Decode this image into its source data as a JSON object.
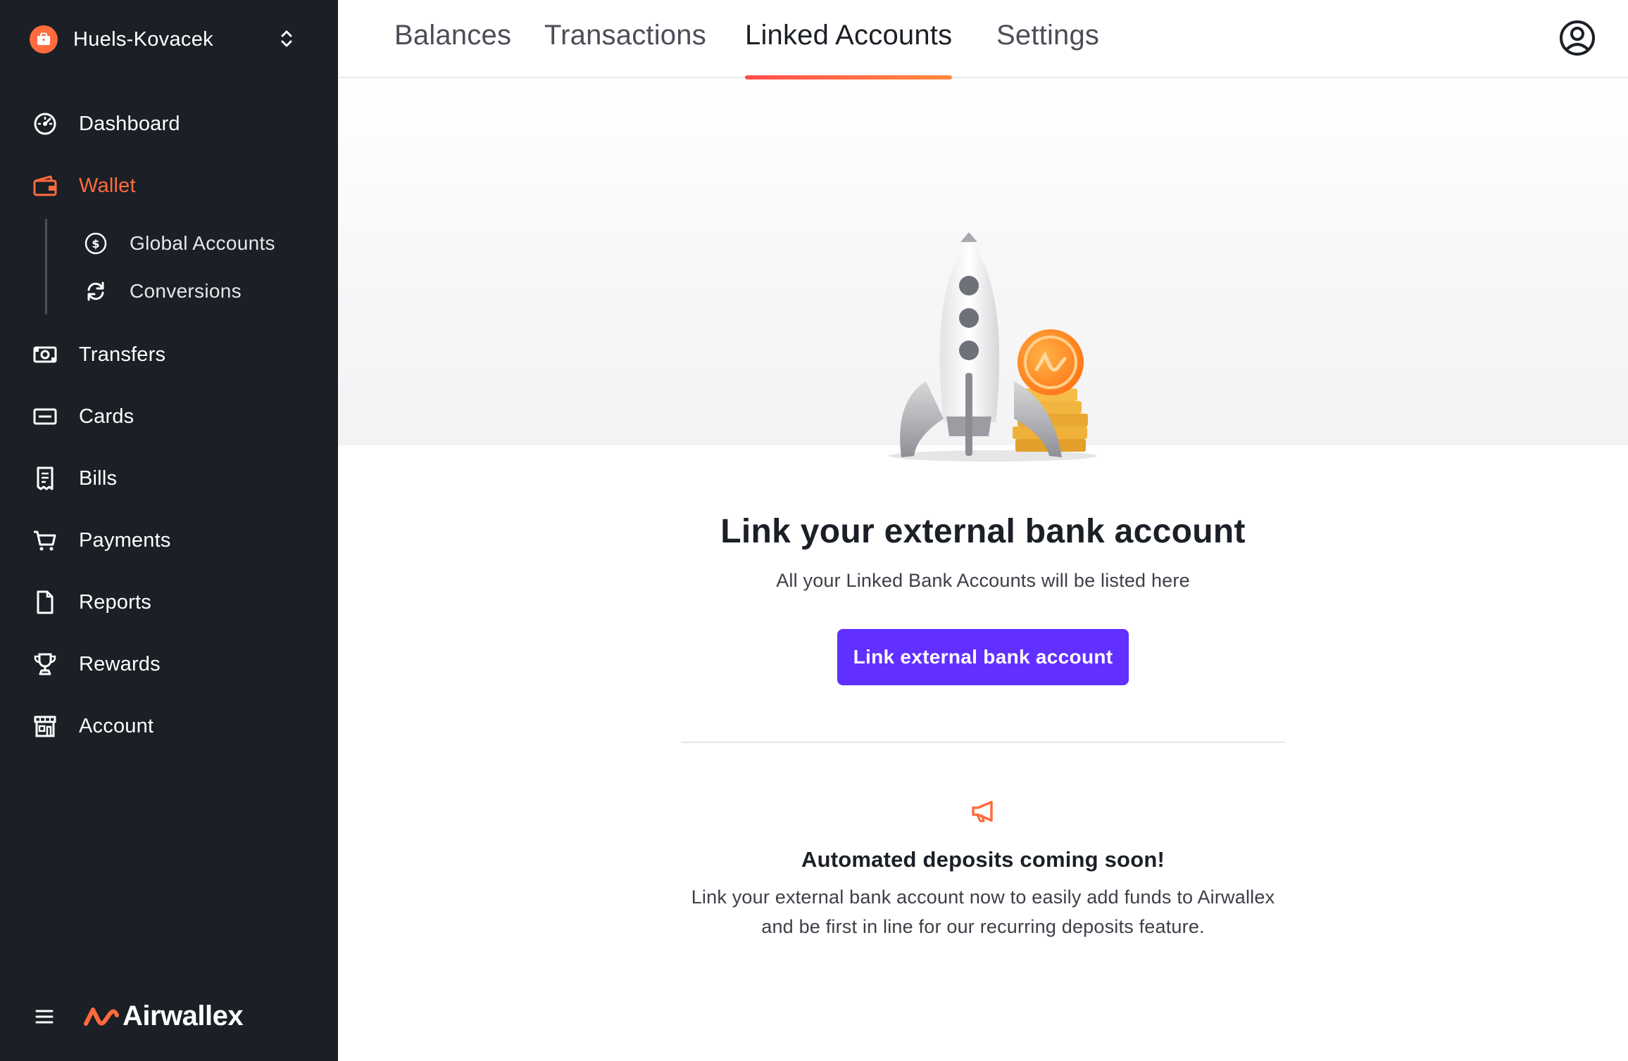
{
  "sidebar": {
    "org_name": "Huels-Kovacek",
    "nav": {
      "dashboard": "Dashboard",
      "wallet": "Wallet",
      "global_accounts": "Global Accounts",
      "conversions": "Conversions",
      "transfers": "Transfers",
      "cards": "Cards",
      "bills": "Bills",
      "payments": "Payments",
      "reports": "Reports",
      "rewards": "Rewards",
      "account": "Account"
    },
    "active_item": "Wallet",
    "logo_text": "Airwallex"
  },
  "tabs": {
    "balances": "Balances",
    "transactions": "Transactions",
    "linked_accounts": "Linked Accounts",
    "settings": "Settings",
    "active": "Linked Accounts"
  },
  "main": {
    "title": "Link your external bank account",
    "subtitle": "All your Linked Bank Accounts will be listed here",
    "cta_label": "Link external bank account",
    "soon_title": "Automated deposits coming soon!",
    "soon_text": "Link your external bank account now to easily add funds to Airwallex and be first in line for our recurring deposits feature."
  },
  "colors": {
    "accent": "#ff6b3d",
    "primary_button": "#612fff",
    "sidebar_bg": "#1b1f26"
  },
  "icons": {
    "org": "briefcase-icon",
    "dashboard": "speedometer-icon",
    "wallet": "wallet-icon",
    "global_accounts": "dollar-circle-icon",
    "conversions": "refresh-icon",
    "transfers": "banknote-icon",
    "cards": "card-icon",
    "bills": "receipt-icon",
    "payments": "cart-icon",
    "reports": "document-icon",
    "rewards": "trophy-icon",
    "account": "store-icon",
    "profile": "user-circle-icon",
    "announcement": "megaphone-icon"
  }
}
